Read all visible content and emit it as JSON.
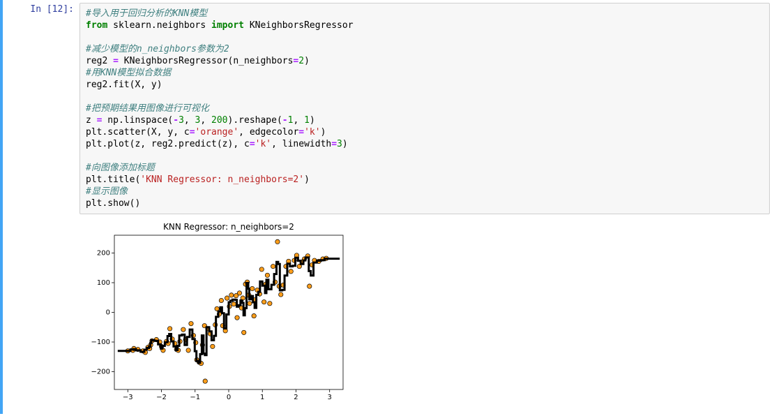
{
  "prompt_label": "In [12]:",
  "code": {
    "l1": "#导入用于回归分析的KNN模型",
    "l2a": "from",
    "l2b": " sklearn.neighbors ",
    "l2c": "import",
    "l2d": " KNeighborsRegressor",
    "l3": "",
    "l4": "#减少模型的n_neighbors参数为2",
    "l5a": "reg2 ",
    "l5b": "=",
    "l5c": " KNeighborsRegressor(n_neighbors",
    "l5d": "=",
    "l5e": "2",
    "l5f": ")",
    "l6": "#用KNN模型拟合数据",
    "l7": "reg2.fit(X, y)",
    "l8": "",
    "l9": "#把预期结果用图像进行可视化",
    "l10a": "z ",
    "l10b": "=",
    "l10c": " np.linspace(",
    "l10d": "-",
    "l10e": "3",
    "l10f": ", ",
    "l10g": "3",
    "l10h": ", ",
    "l10i": "200",
    "l10j": ").reshape(",
    "l10k": "-",
    "l10l": "1",
    "l10m": ", ",
    "l10n": "1",
    "l10o": ")",
    "l11a": "plt.scatter(X, y, c",
    "l11b": "=",
    "l11c": "'orange'",
    "l11d": ", edgecolor",
    "l11e": "=",
    "l11f": "'k'",
    "l11g": ")",
    "l12a": "plt.plot(z, reg2.predict(z), c",
    "l12b": "=",
    "l12c": "'k'",
    "l12d": ", linewidth",
    "l12e": "=",
    "l12f": "3",
    "l12g": ")",
    "l13": "",
    "l14": "#向图像添加标题",
    "l15a": "plt.title(",
    "l15b": "'KNN Regressor: n_neighbors=2'",
    "l15c": ")",
    "l16": "#显示图像",
    "l17": "plt.show()"
  },
  "chart_data": {
    "type": "scatter_line",
    "title": "KNN Regressor: n_neighbors=2",
    "xlabel": "",
    "ylabel": "",
    "xlim": [
      -3.4,
      3.4
    ],
    "ylim": [
      -260,
      260
    ],
    "xticks": [
      -3,
      -2,
      -1,
      0,
      1,
      2,
      3
    ],
    "yticks": [
      -200,
      -100,
      0,
      100,
      200
    ],
    "scatter": [
      [
        -3.0,
        -130
      ],
      [
        -2.85,
        -128
      ],
      [
        -2.82,
        -122
      ],
      [
        -2.7,
        -125
      ],
      [
        -2.55,
        -130
      ],
      [
        -2.48,
        -135
      ],
      [
        -2.4,
        -118
      ],
      [
        -2.35,
        -122
      ],
      [
        -2.32,
        -110
      ],
      [
        -2.28,
        -96
      ],
      [
        -2.15,
        -92
      ],
      [
        -2.05,
        -100
      ],
      [
        -2.0,
        -115
      ],
      [
        -1.95,
        -128
      ],
      [
        -1.85,
        -98
      ],
      [
        -1.8,
        -105
      ],
      [
        -1.75,
        -55
      ],
      [
        -1.68,
        -90
      ],
      [
        -1.6,
        -105
      ],
      [
        -1.55,
        -125
      ],
      [
        -1.5,
        -128
      ],
      [
        -1.45,
        -98
      ],
      [
        -1.35,
        -58
      ],
      [
        -1.28,
        -92
      ],
      [
        -1.2,
        -128
      ],
      [
        -1.12,
        -38
      ],
      [
        -1.05,
        -78
      ],
      [
        -0.98,
        -102
      ],
      [
        -0.95,
        -160
      ],
      [
        -0.88,
        -168
      ],
      [
        -0.82,
        -172
      ],
      [
        -0.78,
        -110
      ],
      [
        -0.72,
        -45
      ],
      [
        -0.7,
        -232
      ],
      [
        -0.62,
        -55
      ],
      [
        -0.55,
        -72
      ],
      [
        -0.48,
        -115
      ],
      [
        -0.4,
        -42
      ],
      [
        -0.35,
        12
      ],
      [
        -0.28,
        -6
      ],
      [
        -0.22,
        40
      ],
      [
        -0.18,
        -45
      ],
      [
        -0.1,
        -62
      ],
      [
        -0.05,
        48
      ],
      [
        0.02,
        20
      ],
      [
        0.08,
        58
      ],
      [
        0.15,
        28
      ],
      [
        0.22,
        56
      ],
      [
        0.25,
        -18
      ],
      [
        0.32,
        65
      ],
      [
        0.38,
        15
      ],
      [
        0.42,
        48
      ],
      [
        0.45,
        -68
      ],
      [
        0.5,
        95
      ],
      [
        0.55,
        102
      ],
      [
        0.6,
        58
      ],
      [
        0.62,
        30
      ],
      [
        0.7,
        80
      ],
      [
        0.75,
        -12
      ],
      [
        0.78,
        42
      ],
      [
        0.85,
        75
      ],
      [
        0.92,
        62
      ],
      [
        0.98,
        145
      ],
      [
        1.05,
        35
      ],
      [
        1.1,
        95
      ],
      [
        1.15,
        125
      ],
      [
        1.22,
        30
      ],
      [
        1.32,
        155
      ],
      [
        1.38,
        102
      ],
      [
        1.45,
        238
      ],
      [
        1.5,
        88
      ],
      [
        1.55,
        60
      ],
      [
        1.62,
        92
      ],
      [
        1.7,
        155
      ],
      [
        1.78,
        172
      ],
      [
        1.85,
        138
      ],
      [
        1.95,
        175
      ],
      [
        2.02,
        192
      ],
      [
        2.1,
        155
      ],
      [
        2.18,
        170
      ],
      [
        2.25,
        180
      ],
      [
        2.35,
        190
      ],
      [
        2.4,
        88
      ],
      [
        2.48,
        160
      ],
      [
        2.55,
        175
      ],
      [
        2.68,
        172
      ],
      [
        2.8,
        180
      ],
      [
        2.9,
        182
      ]
    ],
    "line": [
      [
        -3.3,
        -130
      ],
      [
        -3.0,
        -130
      ],
      [
        -2.92,
        -130
      ],
      [
        -2.92,
        -125
      ],
      [
        -2.83,
        -125
      ],
      [
        -2.83,
        -124
      ],
      [
        -2.76,
        -124
      ],
      [
        -2.76,
        -128
      ],
      [
        -2.62,
        -128
      ],
      [
        -2.62,
        -133
      ],
      [
        -2.51,
        -133
      ],
      [
        -2.51,
        -126
      ],
      [
        -2.44,
        -126
      ],
      [
        -2.44,
        -120
      ],
      [
        -2.37,
        -120
      ],
      [
        -2.37,
        -116
      ],
      [
        -2.33,
        -116
      ],
      [
        -2.33,
        -103
      ],
      [
        -2.3,
        -103
      ],
      [
        -2.3,
        -94
      ],
      [
        -2.21,
        -94
      ],
      [
        -2.21,
        -96
      ],
      [
        -2.1,
        -96
      ],
      [
        -2.1,
        -108
      ],
      [
        -2.02,
        -108
      ],
      [
        -2.02,
        -122
      ],
      [
        -1.97,
        -122
      ],
      [
        -1.97,
        -113
      ],
      [
        -1.9,
        -113
      ],
      [
        -1.9,
        -101
      ],
      [
        -1.82,
        -101
      ],
      [
        -1.82,
        -80
      ],
      [
        -1.77,
        -80
      ],
      [
        -1.77,
        -73
      ],
      [
        -1.71,
        -73
      ],
      [
        -1.71,
        -98
      ],
      [
        -1.64,
        -98
      ],
      [
        -1.64,
        -115
      ],
      [
        -1.57,
        -115
      ],
      [
        -1.57,
        -127
      ],
      [
        -1.52,
        -127
      ],
      [
        -1.52,
        -113
      ],
      [
        -1.47,
        -113
      ],
      [
        -1.47,
        -78
      ],
      [
        -1.39,
        -78
      ],
      [
        -1.39,
        -75
      ],
      [
        -1.31,
        -75
      ],
      [
        -1.31,
        -110
      ],
      [
        -1.24,
        -110
      ],
      [
        -1.24,
        -83
      ],
      [
        -1.16,
        -83
      ],
      [
        -1.16,
        -58
      ],
      [
        -1.08,
        -58
      ],
      [
        -1.08,
        -90
      ],
      [
        -1.01,
        -90
      ],
      [
        -1.01,
        -131
      ],
      [
        -0.96,
        -131
      ],
      [
        -0.96,
        -164
      ],
      [
        -0.9,
        -164
      ],
      [
        -0.9,
        -170
      ],
      [
        -0.85,
        -170
      ],
      [
        -0.85,
        -141
      ],
      [
        -0.8,
        -141
      ],
      [
        -0.8,
        -78
      ],
      [
        -0.75,
        -78
      ],
      [
        -0.75,
        -139
      ],
      [
        -0.71,
        -139
      ],
      [
        -0.71,
        -144
      ],
      [
        -0.66,
        -144
      ],
      [
        -0.66,
        -50
      ],
      [
        -0.58,
        -50
      ],
      [
        -0.58,
        -64
      ],
      [
        -0.51,
        -64
      ],
      [
        -0.51,
        -94
      ],
      [
        -0.44,
        -94
      ],
      [
        -0.44,
        -79
      ],
      [
        -0.38,
        -79
      ],
      [
        -0.38,
        -15
      ],
      [
        -0.31,
        -15
      ],
      [
        -0.31,
        3
      ],
      [
        -0.25,
        3
      ],
      [
        -0.25,
        17
      ],
      [
        -0.2,
        17
      ],
      [
        -0.2,
        -3
      ],
      [
        -0.14,
        -3
      ],
      [
        -0.14,
        -54
      ],
      [
        -0.07,
        -54
      ],
      [
        -0.07,
        -7
      ],
      [
        0.0,
        -7
      ],
      [
        0.0,
        34
      ],
      [
        0.05,
        34
      ],
      [
        0.05,
        39
      ],
      [
        0.11,
        39
      ],
      [
        0.11,
        43
      ],
      [
        0.18,
        43
      ],
      [
        0.18,
        42
      ],
      [
        0.24,
        42
      ],
      [
        0.24,
        19
      ],
      [
        0.29,
        19
      ],
      [
        0.29,
        24
      ],
      [
        0.35,
        24
      ],
      [
        0.35,
        40
      ],
      [
        0.4,
        40
      ],
      [
        0.4,
        32
      ],
      [
        0.44,
        32
      ],
      [
        0.44,
        -10
      ],
      [
        0.48,
        -10
      ],
      [
        0.48,
        14
      ],
      [
        0.53,
        14
      ],
      [
        0.53,
        99
      ],
      [
        0.58,
        99
      ],
      [
        0.58,
        80
      ],
      [
        0.61,
        80
      ],
      [
        0.61,
        44
      ],
      [
        0.66,
        44
      ],
      [
        0.66,
        55
      ],
      [
        0.72,
        55
      ],
      [
        0.72,
        34
      ],
      [
        0.77,
        34
      ],
      [
        0.77,
        15
      ],
      [
        0.82,
        15
      ],
      [
        0.82,
        59
      ],
      [
        0.88,
        59
      ],
      [
        0.88,
        69
      ],
      [
        0.93,
        69
      ],
      [
        0.93,
        104
      ],
      [
        1.0,
        104
      ],
      [
        1.0,
        90
      ],
      [
        1.08,
        90
      ],
      [
        1.08,
        65
      ],
      [
        1.12,
        65
      ],
      [
        1.12,
        110
      ],
      [
        1.18,
        110
      ],
      [
        1.18,
        78
      ],
      [
        1.27,
        78
      ],
      [
        1.27,
        93
      ],
      [
        1.35,
        93
      ],
      [
        1.35,
        129
      ],
      [
        1.42,
        129
      ],
      [
        1.42,
        170
      ],
      [
        1.47,
        170
      ],
      [
        1.47,
        163
      ],
      [
        1.52,
        163
      ],
      [
        1.52,
        74
      ],
      [
        1.59,
        74
      ],
      [
        1.59,
        76
      ],
      [
        1.66,
        76
      ],
      [
        1.66,
        124
      ],
      [
        1.74,
        124
      ],
      [
        1.74,
        164
      ],
      [
        1.82,
        164
      ],
      [
        1.82,
        155
      ],
      [
        1.9,
        155
      ],
      [
        1.9,
        157
      ],
      [
        1.98,
        157
      ],
      [
        1.98,
        184
      ],
      [
        2.06,
        184
      ],
      [
        2.06,
        174
      ],
      [
        2.14,
        174
      ],
      [
        2.14,
        163
      ],
      [
        2.22,
        163
      ],
      [
        2.22,
        175
      ],
      [
        2.28,
        175
      ],
      [
        2.28,
        185
      ],
      [
        2.38,
        185
      ],
      [
        2.38,
        139
      ],
      [
        2.44,
        139
      ],
      [
        2.44,
        124
      ],
      [
        2.52,
        124
      ],
      [
        2.52,
        168
      ],
      [
        2.62,
        168
      ],
      [
        2.62,
        174
      ],
      [
        2.74,
        174
      ],
      [
        2.74,
        176
      ],
      [
        2.85,
        176
      ],
      [
        2.85,
        181
      ],
      [
        3.3,
        181
      ]
    ]
  }
}
